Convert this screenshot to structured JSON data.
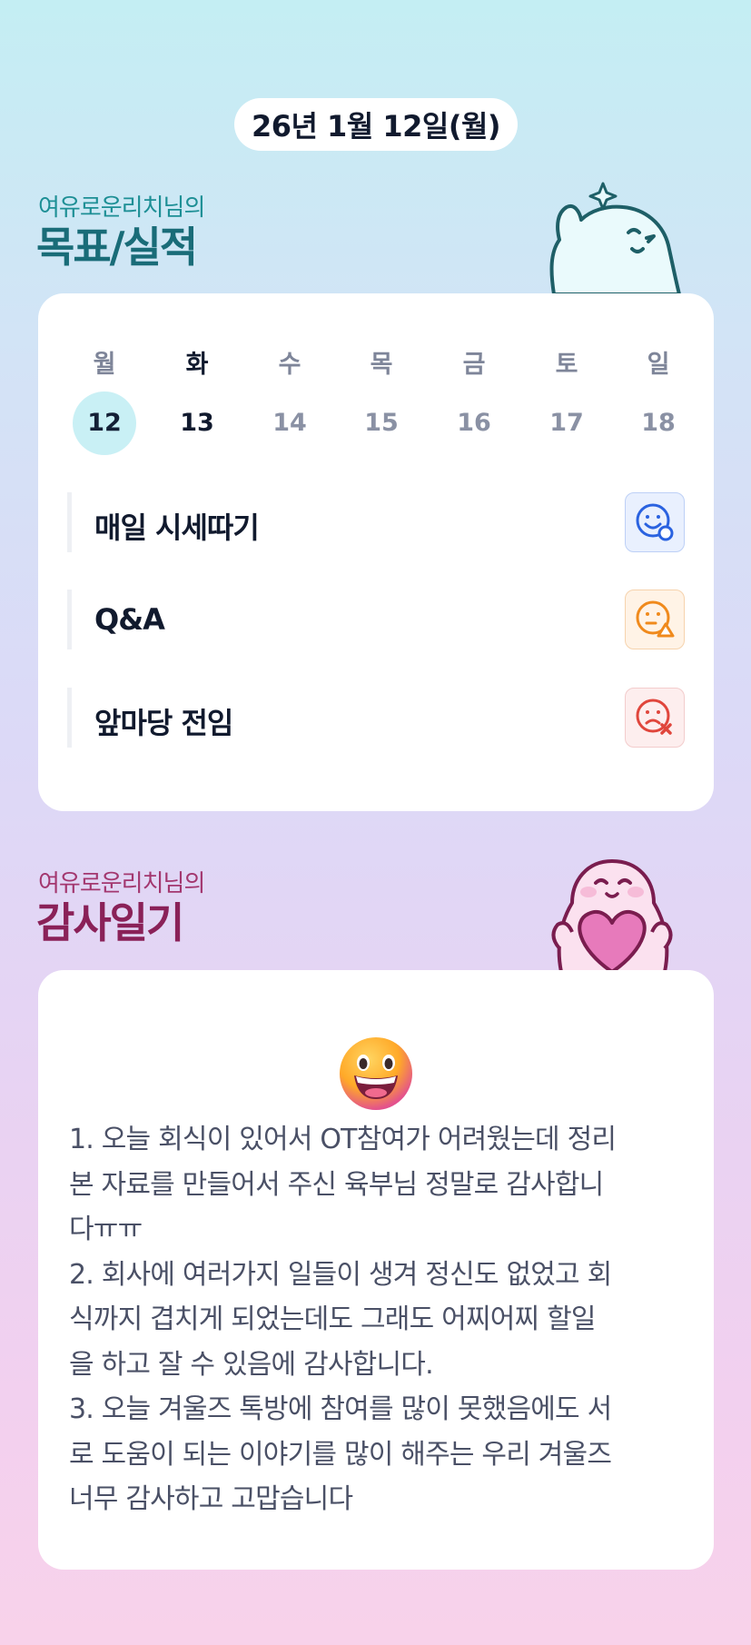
{
  "header": {
    "date": "26년 1월 12일(월)"
  },
  "goals_section": {
    "subtitle": "여유로운리치님의",
    "title": "목표/실적",
    "days": [
      {
        "name": "월",
        "num": "12"
      },
      {
        "name": "화",
        "num": "13"
      },
      {
        "name": "수",
        "num": "14"
      },
      {
        "name": "목",
        "num": "15"
      },
      {
        "name": "금",
        "num": "16"
      },
      {
        "name": "토",
        "num": "17"
      },
      {
        "name": "일",
        "num": "18"
      }
    ],
    "goals": [
      {
        "label": "매일 시세따기",
        "status_icon": "smile-face-icon",
        "color": "#2a62e0"
      },
      {
        "label": "Q&A",
        "status_icon": "neutral-face-icon",
        "color": "#f08a1c"
      },
      {
        "label": "앞마당 전임",
        "status_icon": "sad-face-icon",
        "color": "#e0463c"
      }
    ]
  },
  "thanks_section": {
    "subtitle": "여유로운리치님의",
    "title": "감사일기",
    "emoji": "grinning-face-emoji",
    "text": "1. 오늘 회식이 있어서 OT참여가 어려웠는데 정리\n본 자료를 만들어서 주신 육부님 정말로 감사합니\n다ㅠㅠ\n2. 회사에 여러가지 일들이 생겨 정신도 없었고 회\n식까지 겹치게 되었는데도 그래도 어찌어찌 할일\n을 하고 잘 수 있음에 감사합니다.\n3. 오늘 겨울즈 톡방에 참여를 많이 못했음에도 서\n로 도움이 되는 이야기를 많이 해주는 우리 겨울즈\n너무 감사하고 고맙습니다"
  },
  "colors": {
    "goal_accent": "#196c78",
    "thanks_accent": "#8a2158",
    "active_day_bg": "#c9f0f5"
  }
}
